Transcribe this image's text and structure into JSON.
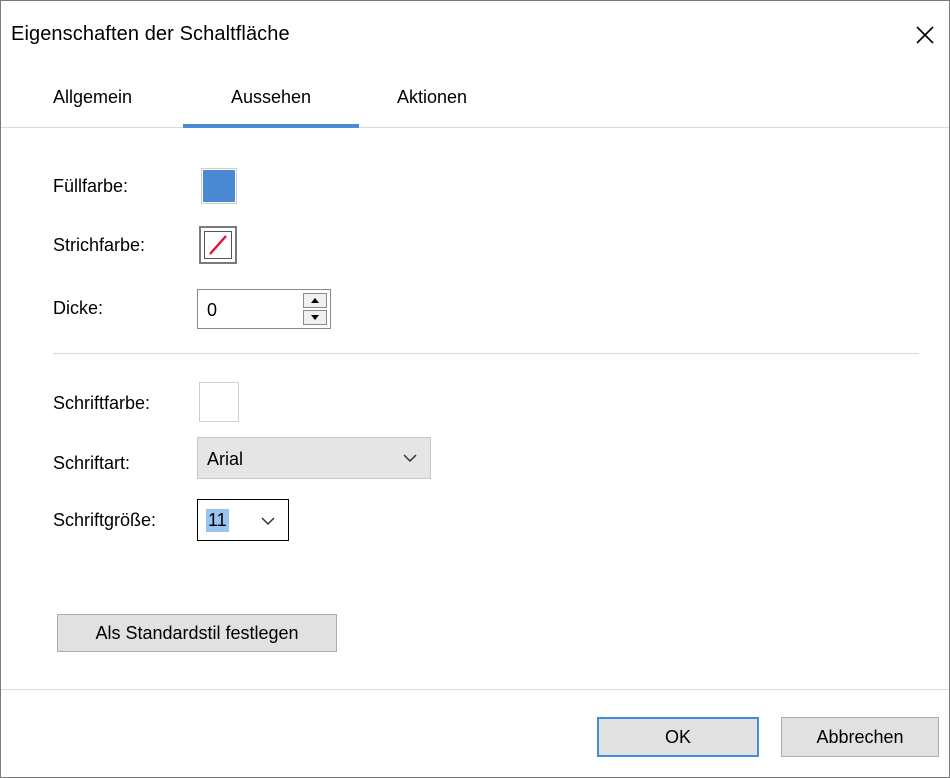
{
  "dialog": {
    "title": "Eigenschaften der Schaltfläche"
  },
  "tabs": [
    {
      "label": "Allgemein",
      "active": false
    },
    {
      "label": "Aussehen",
      "active": true
    },
    {
      "label": "Aktionen",
      "active": false
    }
  ],
  "appearance": {
    "fill_color_label": "Füllfarbe:",
    "fill_color": "#4a8ad4",
    "stroke_color_label": "Strichfarbe:",
    "stroke_color_icon": "no-color-icon",
    "thickness_label": "Dicke:",
    "thickness_value": "0",
    "font_color_label": "Schriftfarbe:",
    "font_color": "#ffffff",
    "font_family_label": "Schriftart:",
    "font_family_value": "Arial",
    "font_size_label": "Schriftgröße:",
    "font_size_value": "11"
  },
  "buttons": {
    "set_default_style": "Als Standardstil festlegen",
    "ok": "OK",
    "cancel": "Abbrechen"
  },
  "colors": {
    "accent": "#4a8ad4",
    "no_color_slash": "#e8112d"
  }
}
